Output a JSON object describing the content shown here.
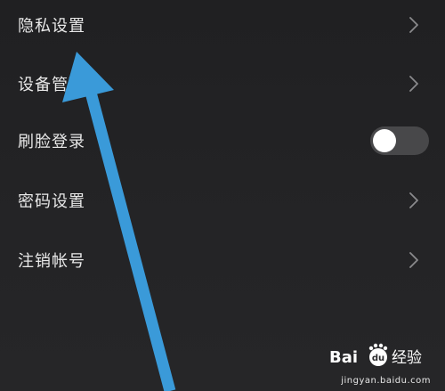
{
  "settings": {
    "items": [
      {
        "label": "隐私设置",
        "control": "chevron-right-icon"
      },
      {
        "label": "设备管理",
        "control": "chevron-right-icon"
      },
      {
        "label": "刷脸登录",
        "control": "toggle",
        "toggle_on": false
      },
      {
        "label": "密码设置",
        "control": "chevron-right-icon"
      },
      {
        "label": "注销帐号",
        "control": "chevron-right-icon"
      }
    ]
  },
  "annotation": {
    "arrow_color": "#3a9ad9"
  },
  "watermark": {
    "logo_text": "Bai du 经验",
    "url": "jingyan.baidu.com"
  },
  "colors": {
    "background": "#232325",
    "text": "#e8e8e8",
    "chevron": "#8a8a8c",
    "toggle_track_off": "#48484a",
    "toggle_knob": "#ffffff"
  }
}
